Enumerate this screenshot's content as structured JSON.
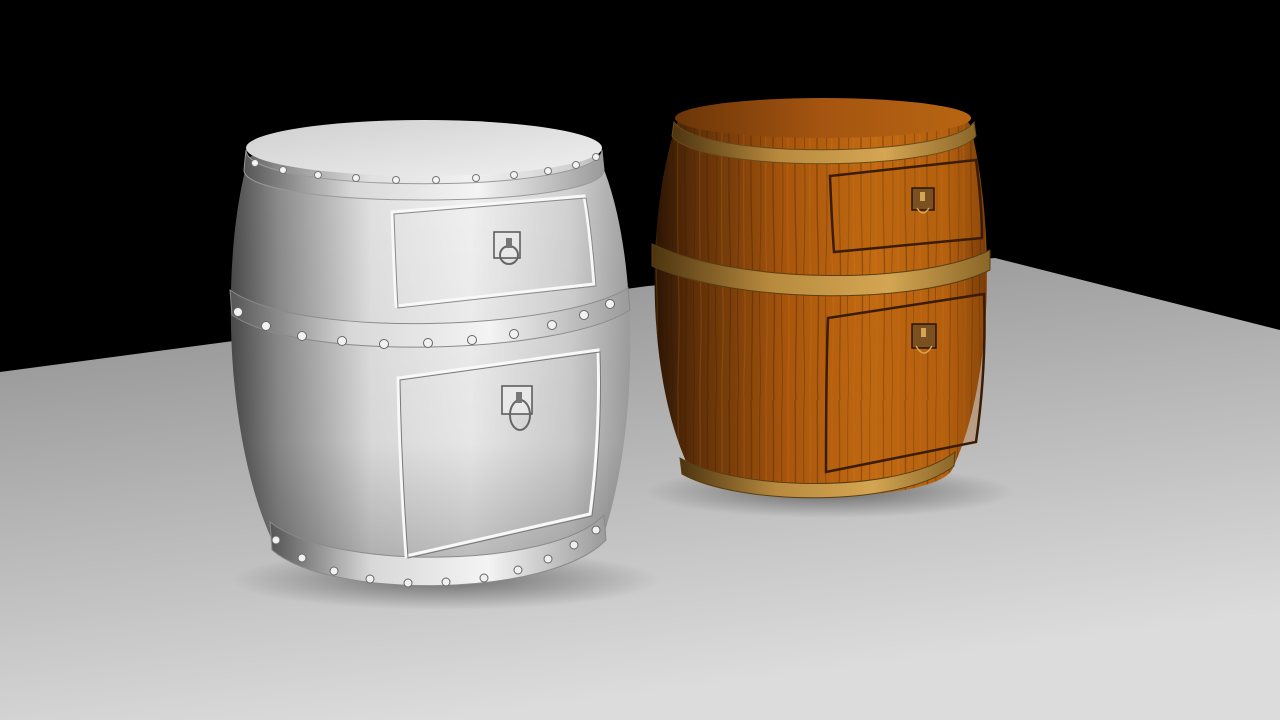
{
  "scene": {
    "background_color": "#000000",
    "floor_color_far": "#8a8a8a",
    "floor_color_near": "#dcdcdc",
    "objects": [
      {
        "id": "barrel-untextured",
        "material": "clay-white",
        "body_color": "#e6e6e6",
        "shadow_color": "#3c3c3c",
        "drawer_count": 2,
        "has_rivets": true,
        "has_ring_handles": true
      },
      {
        "id": "barrel-textured",
        "material": "wood",
        "body_color": "#b8620f",
        "shadow_color": "#2a1404",
        "band_color": "#b88a3e",
        "drawer_count": 2,
        "has_rivets": false,
        "has_ring_handles": true
      }
    ]
  }
}
